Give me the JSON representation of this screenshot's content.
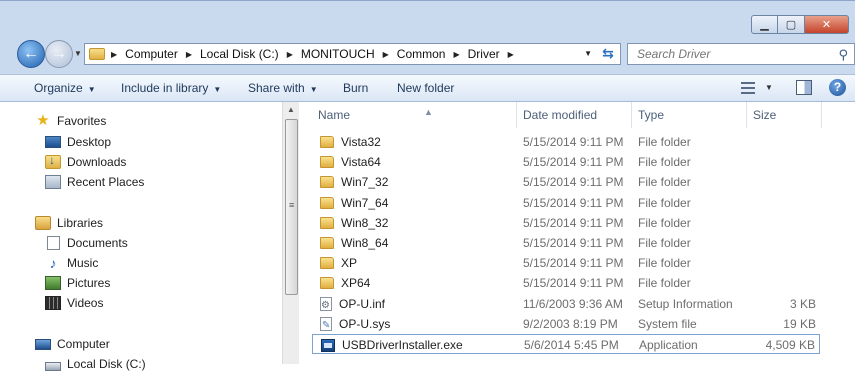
{
  "address": {
    "crumbs": [
      "Computer",
      "Local Disk (C:)",
      "MONITOUCH",
      "Common",
      "Driver"
    ]
  },
  "search": {
    "placeholder": "Search Driver"
  },
  "toolbar": {
    "organize": "Organize",
    "include_in_library": "Include in library",
    "share_with": "Share with",
    "burn": "Burn",
    "new_folder": "New folder"
  },
  "nav": {
    "favorites": "Favorites",
    "desktop": "Desktop",
    "downloads": "Downloads",
    "recent_places": "Recent Places",
    "libraries": "Libraries",
    "documents": "Documents",
    "music": "Music",
    "pictures": "Pictures",
    "videos": "Videos",
    "computer": "Computer",
    "local_disk": "Local Disk (C:)"
  },
  "columns": {
    "name": "Name",
    "date_modified": "Date modified",
    "type": "Type",
    "size": "Size"
  },
  "files": [
    {
      "name": "Vista32",
      "date": "5/15/2014 9:11 PM",
      "type": "File folder",
      "size": "",
      "icon": "folder"
    },
    {
      "name": "Vista64",
      "date": "5/15/2014 9:11 PM",
      "type": "File folder",
      "size": "",
      "icon": "folder"
    },
    {
      "name": "Win7_32",
      "date": "5/15/2014 9:11 PM",
      "type": "File folder",
      "size": "",
      "icon": "folder"
    },
    {
      "name": "Win7_64",
      "date": "5/15/2014 9:11 PM",
      "type": "File folder",
      "size": "",
      "icon": "folder"
    },
    {
      "name": "Win8_32",
      "date": "5/15/2014 9:11 PM",
      "type": "File folder",
      "size": "",
      "icon": "folder"
    },
    {
      "name": "Win8_64",
      "date": "5/15/2014 9:11 PM",
      "type": "File folder",
      "size": "",
      "icon": "folder"
    },
    {
      "name": "XP",
      "date": "5/15/2014 9:11 PM",
      "type": "File folder",
      "size": "",
      "icon": "folder"
    },
    {
      "name": "XP64",
      "date": "5/15/2014 9:11 PM",
      "type": "File folder",
      "size": "",
      "icon": "folder"
    },
    {
      "name": "OP-U.inf",
      "date": "11/6/2003 9:36 AM",
      "type": "Setup Information",
      "size": "3 KB",
      "icon": "inf"
    },
    {
      "name": "OP-U.sys",
      "date": "9/2/2003 8:19 PM",
      "type": "System file",
      "size": "19 KB",
      "icon": "sys"
    },
    {
      "name": "USBDriverInstaller.exe",
      "date": "5/6/2014 5:45 PM",
      "type": "Application",
      "size": "4,509 KB",
      "icon": "exe"
    }
  ]
}
